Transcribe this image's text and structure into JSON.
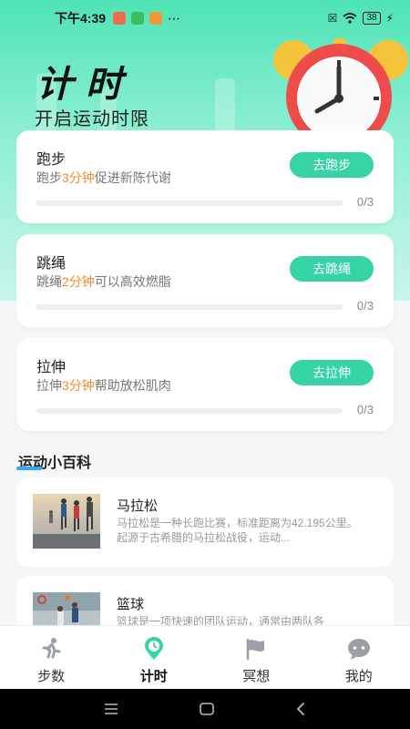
{
  "status": {
    "time": "下午4:39",
    "battery": "38"
  },
  "header": {
    "title": "计时",
    "subtitle": "开启运动时限"
  },
  "cards": [
    {
      "title": "跑步",
      "desc_pre": "跑步",
      "desc_hl": "3分钟",
      "desc_post": "促进新陈代谢",
      "button": "去跑步",
      "progress_text": "0/3",
      "progress": 0
    },
    {
      "title": "跳绳",
      "desc_pre": "跳绳",
      "desc_hl": "2分钟",
      "desc_post": "可以高效燃脂",
      "button": "去跳绳",
      "progress_text": "0/3",
      "progress": 0
    },
    {
      "title": "拉伸",
      "desc_pre": "拉伸",
      "desc_hl": "3分钟",
      "desc_post": "帮助放松肌肉",
      "button": "去拉伸",
      "progress_text": "0/3",
      "progress": 0
    }
  ],
  "section": {
    "title": "运动小百科"
  },
  "encyclopedia": [
    {
      "title": "马拉松",
      "desc": "马拉松是一种长跑比赛，标准距离为42.195公里。起源于古希腊的马拉松战役，运动..."
    },
    {
      "title": "篮球",
      "desc": "篮球是一项快速的团队运动，通常由两队各"
    }
  ],
  "tabs": [
    {
      "label": "步数",
      "icon": "runner-icon"
    },
    {
      "label": "计时",
      "icon": "timer-pin-icon",
      "active": true
    },
    {
      "label": "冥想",
      "icon": "flag-icon"
    },
    {
      "label": "我的",
      "icon": "chat-bubble-icon"
    }
  ],
  "colors": {
    "accent": "#36d3a4",
    "highlight": "#f58a2a",
    "header_gradient_top": "#4fe3b6",
    "clock_red": "#ee4b4b"
  }
}
